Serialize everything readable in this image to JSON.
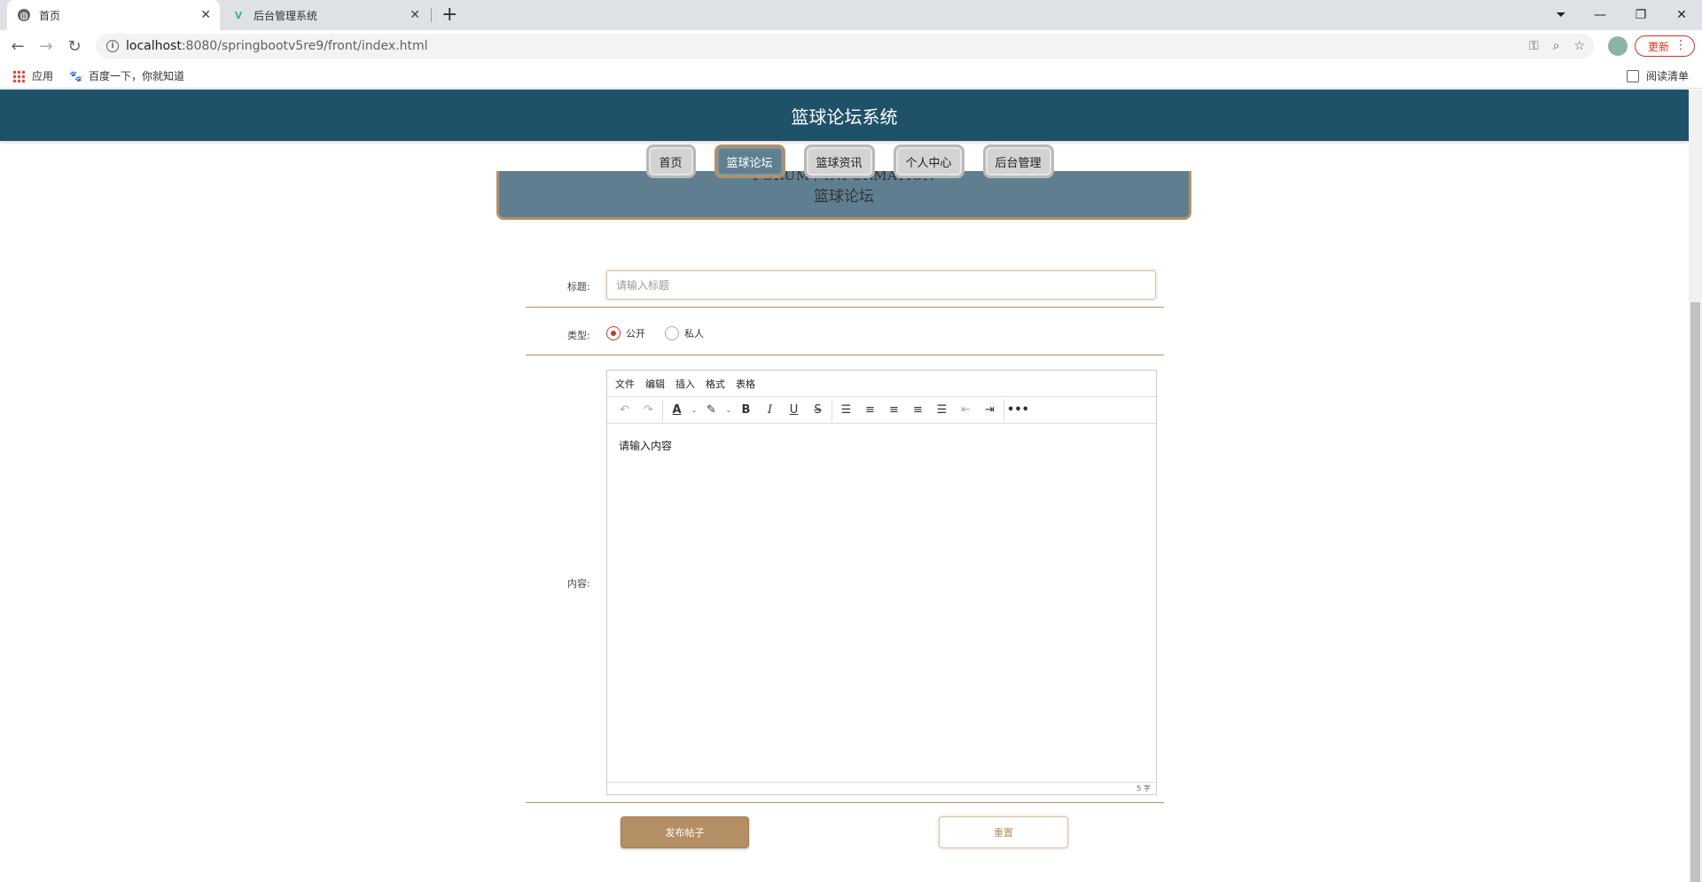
{
  "browser": {
    "tabs": [
      {
        "title": "首页",
        "icon": "globe-icon"
      },
      {
        "title": "后台管理系统",
        "icon": "vue-logo-icon"
      }
    ],
    "url_host": "localhost",
    "url_rest": ":8080/springbootv5re9/front/index.html",
    "update_label": "更新",
    "bookmarks": {
      "apps": "应用",
      "baidu": "百度一下，你就知道",
      "reading_list": "阅读清单"
    }
  },
  "header": {
    "title": "篮球论坛系统"
  },
  "nav": [
    {
      "label": "首页",
      "active": false
    },
    {
      "label": "篮球论坛",
      "active": true
    },
    {
      "label": "篮球资讯",
      "active": false
    },
    {
      "label": "个人中心",
      "active": false
    },
    {
      "label": "后台管理",
      "active": false
    }
  ],
  "banner": {
    "en": "FORUM / INFORMATION",
    "zh": "篮球论坛"
  },
  "form": {
    "title_label": "标题:",
    "title_placeholder": "请输入标题",
    "type_label": "类型:",
    "type_options": [
      {
        "label": "公开",
        "selected": true
      },
      {
        "label": "私人",
        "selected": false
      }
    ],
    "content_label": "内容:",
    "editor": {
      "menus": [
        "文件",
        "编辑",
        "插入",
        "格式",
        "表格"
      ],
      "placeholder_content": "请输入内容",
      "word_count": "5 字"
    },
    "submit_label": "发布帖子",
    "reset_label": "重置"
  },
  "colors": {
    "header": "#1f5269",
    "accent": "#b48f66",
    "banner": "#5f7f91"
  }
}
